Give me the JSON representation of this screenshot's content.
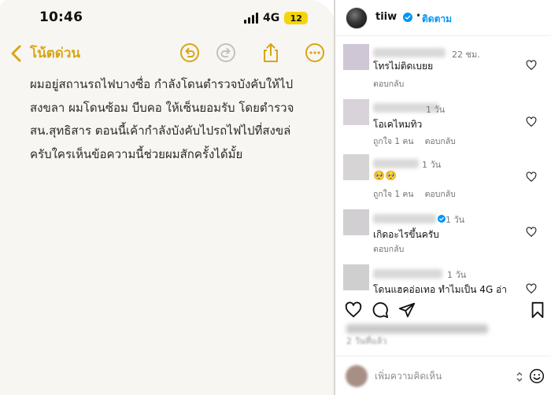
{
  "phone": {
    "status": {
      "time": "10:46",
      "network": "4G",
      "battery": "12"
    },
    "toolbar": {
      "back_label": "โน้ตด่วน",
      "icons": [
        "undo-icon",
        "redo-icon",
        "share-icon",
        "more-icon"
      ]
    },
    "note_text": "ผมอยู่สถานรถไฟบางซื่อ กำลังโดนตำรวจบังคับให้ไป\nสงขลา ผมโดนซ้อม บีบคอ ให้เซ็นยอมรับ โดยตำรวจ\nสน.สุทธิสาร ตอนนี้เค้ากำลังบังคับไปรถไฟไปที่สงขล่\nครับใครเห็นข้อความนี้ช่วยผมสักครั้งได้มั้ย",
    "colors": {
      "accent": "#d9a514",
      "background": "#f7f6f2"
    }
  },
  "instagram": {
    "header": {
      "username": "tiiw",
      "dot": "•",
      "follow_label": "ติดตาม"
    },
    "comments": [
      {
        "time": "22 ชม.",
        "text": "โทรไม่ติดเบยย",
        "likes": "",
        "reply": "ตอบกลับ"
      },
      {
        "time": "1 วัน",
        "text": "โอเคไหมทิว",
        "likes": "ถูกใจ 1 คน",
        "reply": "ตอบกลับ"
      },
      {
        "time": "1 วัน",
        "text": "🥺🥺",
        "likes": "ถูกใจ 1 คน",
        "reply": "ตอบกลับ"
      },
      {
        "time": "1 วัน",
        "text": "เกิดอะไรขึ้นครับ",
        "likes": "",
        "reply": "ตอบกลับ"
      },
      {
        "time": "1 วัน",
        "text": "โดนแฮคอ่อเทอ ทำไมเป็น 4G อ่า",
        "likes": "",
        "reply": ""
      }
    ],
    "post_time": "2 วันที่แล้ว",
    "comment_placeholder": "เพิ่มความคิดเห็น",
    "colors": {
      "follow": "#0095f6",
      "verified": "#0095f6"
    }
  }
}
